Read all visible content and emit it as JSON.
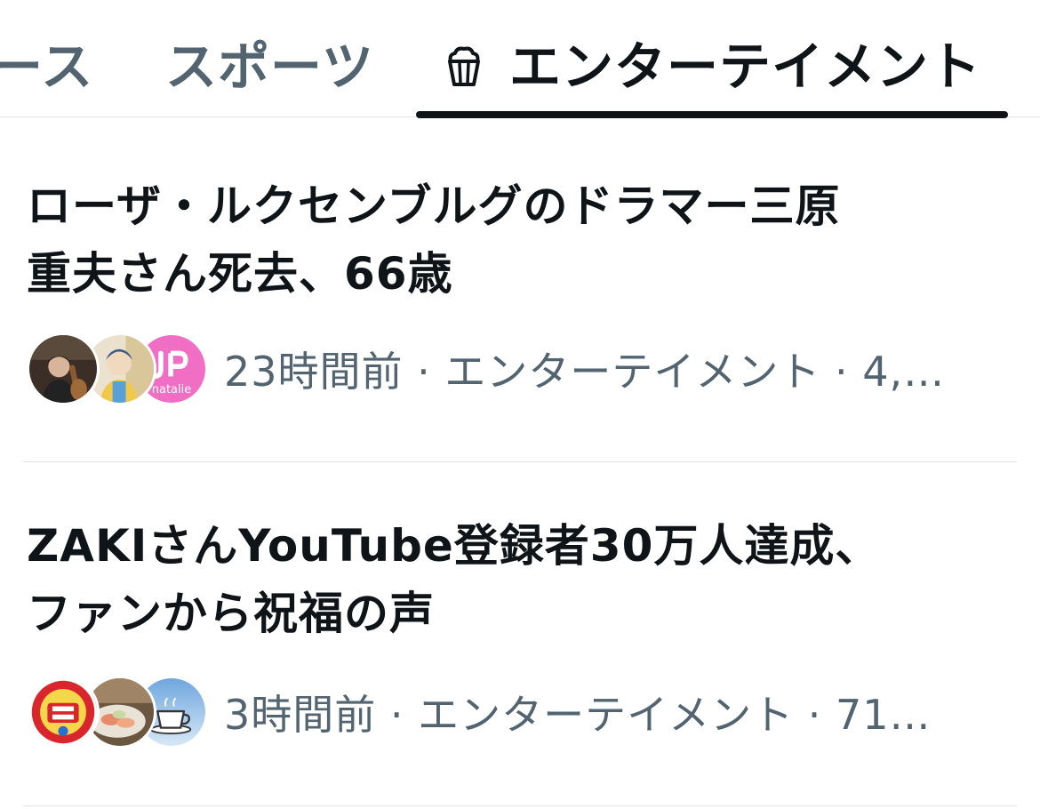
{
  "tabs": [
    {
      "label": "ース",
      "active": false
    },
    {
      "label": "スポーツ",
      "active": false
    },
    {
      "label": "エンターテイメント",
      "active": true,
      "icon": "popcorn-icon"
    }
  ],
  "articles": [
    {
      "headline_lines": [
        "ローザ・ルクセンブルグのドラマー三原",
        "重夫さん死去、66歳"
      ],
      "meta": "23時間前 · エンターテイメント · 4,…",
      "avatars": [
        "person-photo-avatar",
        "illustration-avatar",
        "natalie-logo-avatar"
      ],
      "avatar_text": {
        "natalie": "natalie"
      }
    },
    {
      "headline_lines": [
        "ZAKIさんYouTube登録者30万人達成、",
        "ファンから祝福の声"
      ],
      "meta": "3時間前 · エンターテイメント · 71…",
      "avatars": [
        "takoyaki-logo-avatar",
        "food-photo-avatar",
        "coffee-cup-avatar"
      ]
    }
  ],
  "colors": {
    "text_primary": "#0f1419",
    "text_secondary": "#536471",
    "divider": "#dfe3e6",
    "natalie_pink": "#f06ec4"
  }
}
